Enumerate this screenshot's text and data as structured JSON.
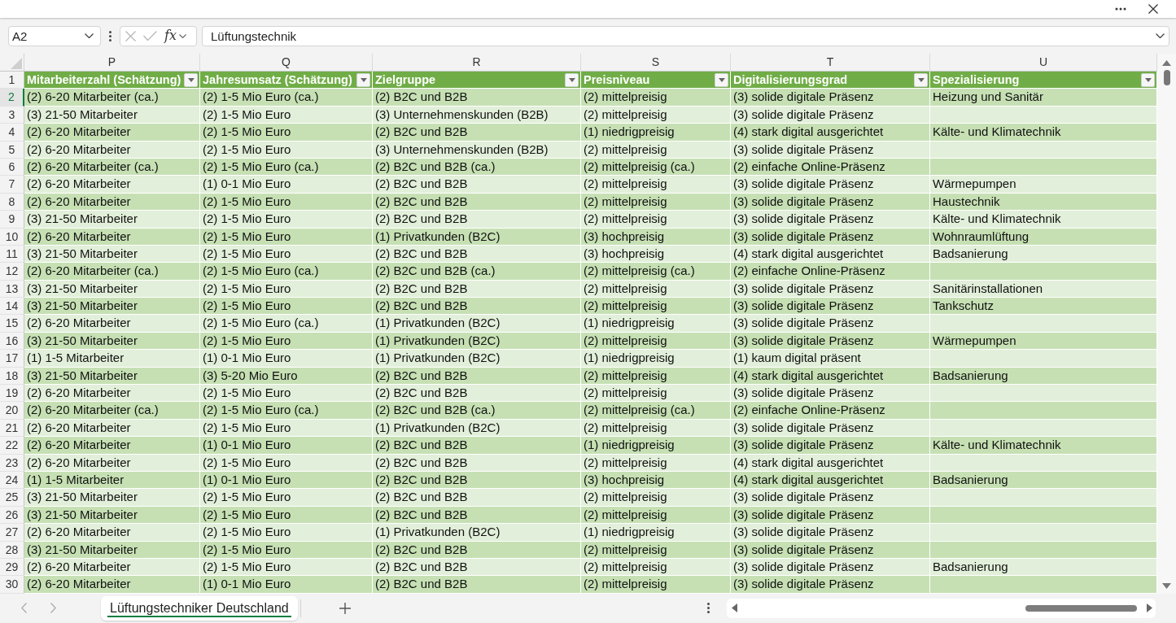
{
  "formula_bar": {
    "name_box": "A2",
    "function_label": "fx",
    "formula": "Lüftungstechnik"
  },
  "sheet": {
    "columns": [
      {
        "letter": "P",
        "header": "Mitarbeiterzahl (Schätzung)"
      },
      {
        "letter": "Q",
        "header": "Jahresumsatz (Schätzung)"
      },
      {
        "letter": "R",
        "header": "Zielgruppe"
      },
      {
        "letter": "S",
        "header": "Preisniveau"
      },
      {
        "letter": "T",
        "header": "Digitalisierungsgrad"
      },
      {
        "letter": "U",
        "header": "Spezialisierung"
      }
    ],
    "header_row_number": "1",
    "rows": [
      {
        "number": "2",
        "selected": true,
        "cells": [
          "(2) 6-20 Mitarbeiter (ca.)",
          "(2) 1-5 Mio Euro (ca.)",
          "(2) B2C und B2B",
          "(2) mittelpreisig",
          "(3) solide digitale Präsenz",
          "Heizung und Sanitär"
        ]
      },
      {
        "number": "3",
        "selected": false,
        "cells": [
          "(3) 21-50 Mitarbeiter",
          "(2) 1-5 Mio Euro",
          "(3) Unternehmenskunden (B2B)",
          "(2) mittelpreisig",
          "(3) solide digitale Präsenz"
        ]
      },
      {
        "number": "4",
        "selected": false,
        "cells": [
          "(2) 6-20 Mitarbeiter",
          "(2) 1-5 Mio Euro",
          "(2) B2C und B2B",
          "(1) niedrigpreisig",
          "(4) stark digital ausgerichtet",
          "Kälte- und Klimatechnik"
        ]
      },
      {
        "number": "5",
        "selected": false,
        "cells": [
          "(2) 6-20 Mitarbeiter",
          "(2) 1-5 Mio Euro",
          "(3) Unternehmenskunden (B2B)",
          "(2) mittelpreisig",
          "(3) solide digitale Präsenz"
        ]
      },
      {
        "number": "6",
        "selected": false,
        "cells": [
          "(2) 6-20 Mitarbeiter (ca.)",
          "(2) 1-5 Mio Euro (ca.)",
          "(2) B2C und B2B (ca.)",
          "(2) mittelpreisig (ca.)",
          "(2) einfache Online-Präsenz"
        ]
      },
      {
        "number": "7",
        "selected": false,
        "cells": [
          "(2) 6-20 Mitarbeiter",
          "(1) 0-1 Mio Euro",
          "(2) B2C und B2B",
          "(2) mittelpreisig",
          "(3) solide digitale Präsenz",
          "Wärmepumpen"
        ]
      },
      {
        "number": "8",
        "selected": false,
        "cells": [
          "(2) 6-20 Mitarbeiter",
          "(2) 1-5 Mio Euro",
          "(2) B2C und B2B",
          "(2) mittelpreisig",
          "(3) solide digitale Präsenz",
          "Haustechnik"
        ]
      },
      {
        "number": "9",
        "selected": false,
        "cells": [
          "(3) 21-50 Mitarbeiter",
          "(2) 1-5 Mio Euro",
          "(2) B2C und B2B",
          "(2) mittelpreisig",
          "(3) solide digitale Präsenz",
          "Kälte- und Klimatechnik"
        ]
      },
      {
        "number": "10",
        "selected": false,
        "cells": [
          "(2) 6-20 Mitarbeiter",
          "(2) 1-5 Mio Euro",
          "(1) Privatkunden (B2C)",
          "(3) hochpreisig",
          "(3) solide digitale Präsenz",
          "Wohnraumlüftung"
        ]
      },
      {
        "number": "11",
        "selected": false,
        "cells": [
          "(3) 21-50 Mitarbeiter",
          "(2) 1-5 Mio Euro",
          "(2) B2C und B2B",
          "(3) hochpreisig",
          "(4) stark digital ausgerichtet",
          "Badsanierung"
        ]
      },
      {
        "number": "12",
        "selected": false,
        "cells": [
          "(2) 6-20 Mitarbeiter (ca.)",
          "(2) 1-5 Mio Euro (ca.)",
          "(2) B2C und B2B (ca.)",
          "(2) mittelpreisig (ca.)",
          "(2) einfache Online-Präsenz"
        ]
      },
      {
        "number": "13",
        "selected": false,
        "cells": [
          "(3) 21-50 Mitarbeiter",
          "(2) 1-5 Mio Euro",
          "(2) B2C und B2B",
          "(2) mittelpreisig",
          "(3) solide digitale Präsenz",
          "Sanitärinstallationen"
        ]
      },
      {
        "number": "14",
        "selected": false,
        "cells": [
          "(3) 21-50 Mitarbeiter",
          "(2) 1-5 Mio Euro",
          "(2) B2C und B2B",
          "(2) mittelpreisig",
          "(3) solide digitale Präsenz",
          "Tankschutz"
        ]
      },
      {
        "number": "15",
        "selected": false,
        "cells": [
          "(2) 6-20 Mitarbeiter",
          "(2) 1-5 Mio Euro (ca.)",
          "(1) Privatkunden (B2C)",
          "(1) niedrigpreisig",
          "(3) solide digitale Präsenz"
        ]
      },
      {
        "number": "16",
        "selected": false,
        "cells": [
          "(3) 21-50 Mitarbeiter",
          "(2) 1-5 Mio Euro",
          "(1) Privatkunden (B2C)",
          "(2) mittelpreisig",
          "(3) solide digitale Präsenz",
          "Wärmepumpen"
        ]
      },
      {
        "number": "17",
        "selected": false,
        "cells": [
          "(1) 1-5 Mitarbeiter",
          "(1) 0-1 Mio Euro",
          "(1) Privatkunden (B2C)",
          "(1) niedrigpreisig",
          "(1) kaum digital präsent"
        ]
      },
      {
        "number": "18",
        "selected": false,
        "cells": [
          "(3) 21-50 Mitarbeiter",
          "(3) 5-20 Mio Euro",
          "(2) B2C und B2B",
          "(2) mittelpreisig",
          "(4) stark digital ausgerichtet",
          "Badsanierung"
        ]
      },
      {
        "number": "19",
        "selected": false,
        "cells": [
          "(2) 6-20 Mitarbeiter",
          "(2) 1-5 Mio Euro",
          "(2) B2C und B2B",
          "(2) mittelpreisig",
          "(3) solide digitale Präsenz"
        ]
      },
      {
        "number": "20",
        "selected": false,
        "cells": [
          "(2) 6-20 Mitarbeiter (ca.)",
          "(2) 1-5 Mio Euro (ca.)",
          "(2) B2C und B2B (ca.)",
          "(2) mittelpreisig (ca.)",
          "(2) einfache Online-Präsenz"
        ]
      },
      {
        "number": "21",
        "selected": false,
        "cells": [
          "(2) 6-20 Mitarbeiter",
          "(2) 1-5 Mio Euro",
          "(1) Privatkunden (B2C)",
          "(2) mittelpreisig",
          "(3) solide digitale Präsenz"
        ]
      },
      {
        "number": "22",
        "selected": false,
        "cells": [
          "(2) 6-20 Mitarbeiter",
          "(1) 0-1 Mio Euro",
          "(2) B2C und B2B",
          "(1) niedrigpreisig",
          "(3) solide digitale Präsenz",
          "Kälte- und Klimatechnik"
        ]
      },
      {
        "number": "23",
        "selected": false,
        "cells": [
          "(2) 6-20 Mitarbeiter",
          "(2) 1-5 Mio Euro",
          "(2) B2C und B2B",
          "(2) mittelpreisig",
          "(4) stark digital ausgerichtet"
        ]
      },
      {
        "number": "24",
        "selected": false,
        "cells": [
          "(1) 1-5 Mitarbeiter",
          "(1) 0-1 Mio Euro",
          "(2) B2C und B2B",
          "(3) hochpreisig",
          "(4) stark digital ausgerichtet",
          "Badsanierung"
        ]
      },
      {
        "number": "25",
        "selected": false,
        "cells": [
          "(3) 21-50 Mitarbeiter",
          "(2) 1-5 Mio Euro",
          "(2) B2C und B2B",
          "(2) mittelpreisig",
          "(3) solide digitale Präsenz"
        ]
      },
      {
        "number": "26",
        "selected": false,
        "cells": [
          "(3) 21-50 Mitarbeiter",
          "(2) 1-5 Mio Euro",
          "(2) B2C und B2B",
          "(2) mittelpreisig",
          "(3) solide digitale Präsenz"
        ]
      },
      {
        "number": "27",
        "selected": false,
        "cells": [
          "(2) 6-20 Mitarbeiter",
          "(2) 1-5 Mio Euro",
          "(1) Privatkunden (B2C)",
          "(1) niedrigpreisig",
          "(3) solide digitale Präsenz"
        ]
      },
      {
        "number": "28",
        "selected": false,
        "cells": [
          "(3) 21-50 Mitarbeiter",
          "(2) 1-5 Mio Euro",
          "(2) B2C und B2B",
          "(2) mittelpreisig",
          "(3) solide digitale Präsenz"
        ]
      },
      {
        "number": "29",
        "selected": false,
        "cells": [
          "(2) 6-20 Mitarbeiter",
          "(2) 1-5 Mio Euro",
          "(2) B2C und B2B",
          "(2) mittelpreisig",
          "(3) solide digitale Präsenz",
          "Badsanierung"
        ]
      },
      {
        "number": "30",
        "selected": false,
        "cells": [
          "(2) 6-20 Mitarbeiter",
          "(1) 0-1 Mio Euro",
          "(2) B2C und B2B",
          "(2) mittelpreisig",
          "(3) solide digitale Präsenz"
        ]
      }
    ]
  },
  "sheet_tabs": [
    {
      "label": "Lüftungstechniker Deutschland",
      "selected": true
    }
  ]
}
